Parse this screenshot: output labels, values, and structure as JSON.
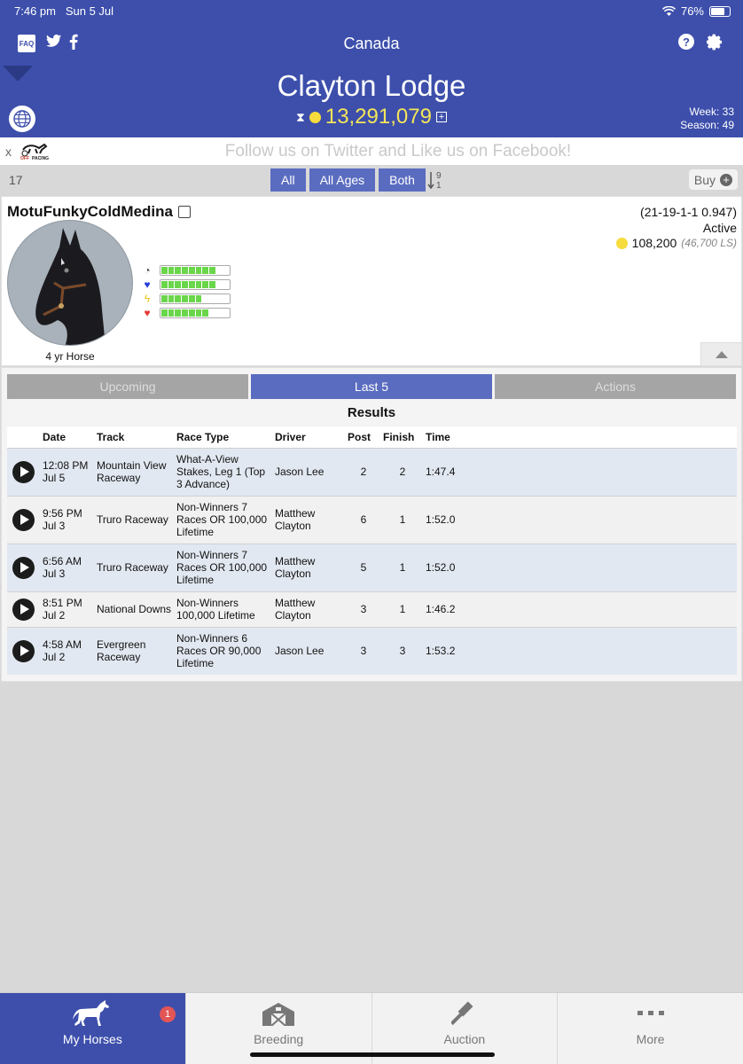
{
  "status": {
    "time": "7:46 pm",
    "date": "Sun 5 Jul",
    "battery": "76%",
    "battery_level": 0.76
  },
  "nav": {
    "title": "Canada",
    "faq": "FAQ",
    "twitter": "twitter-icon",
    "facebook": "facebook-icon",
    "help": "?",
    "settings": "gear-icon"
  },
  "header": {
    "lodge_name": "Clayton Lodge",
    "money": "13,291,079",
    "week_label": "Week: 33",
    "season_label": "Season: 49"
  },
  "banner": {
    "close": "x",
    "logo_line1": "OFF",
    "logo_line2": "PACING",
    "text": "Follow us on Twitter and Like us on Facebook!"
  },
  "filters": {
    "count": "17",
    "buttons": [
      "All",
      "All Ages",
      "Both"
    ],
    "sort_top": "9",
    "sort_bottom": "1",
    "buy": "Buy"
  },
  "horse": {
    "name": "MotuFunkyColdMedina",
    "record": "(21-19-1-1 0.947)",
    "status": "Active",
    "earnings": "108,200",
    "earnings_ls": "(46,700 LS)",
    "age_label": "4 yr Horse",
    "stats": [
      {
        "icon": "speed-icon",
        "glyph": "◔",
        "color": "#444",
        "level": 0.75
      },
      {
        "icon": "heart-monitor-icon",
        "glyph": "♥",
        "color": "#2a3fd6",
        "level": 0.84
      },
      {
        "icon": "lightning-icon",
        "glyph": "ϟ",
        "color": "#f1c40f",
        "level": 0.58
      },
      {
        "icon": "heart-icon",
        "glyph": "♥",
        "color": "#e53935",
        "level": 0.66
      }
    ]
  },
  "tabs": {
    "upcoming": "Upcoming",
    "last5": "Last 5",
    "actions": "Actions"
  },
  "results": {
    "title": "Results",
    "headers": {
      "date": "Date",
      "track": "Track",
      "race_type": "Race Type",
      "driver": "Driver",
      "post": "Post",
      "finish": "Finish",
      "time": "Time"
    },
    "rows": [
      {
        "time_of_day": "12:08 PM",
        "date": "Jul 5",
        "track": "Mountain View Raceway",
        "race_type": "What-A-View Stakes, Leg 1 (Top 3 Advance)",
        "driver": "Jason Lee",
        "post": "2",
        "finish": "2",
        "race_time": "1:47.4"
      },
      {
        "time_of_day": "9:56 PM",
        "date": "Jul 3",
        "track": "Truro Raceway",
        "race_type": "Non-Winners 7 Races OR 100,000 Lifetime",
        "driver": "Matthew Clayton",
        "post": "6",
        "finish": "1",
        "race_time": "1:52.0"
      },
      {
        "time_of_day": "6:56 AM",
        "date": "Jul 3",
        "track": "Truro Raceway",
        "race_type": "Non-Winners 7 Races OR 100,000 Lifetime",
        "driver": "Matthew Clayton",
        "post": "5",
        "finish": "1",
        "race_time": "1:52.0"
      },
      {
        "time_of_day": "8:51 PM",
        "date": "Jul 2",
        "track": "National Downs",
        "race_type": "Non-Winners 100,000 Lifetime",
        "driver": "Matthew Clayton",
        "post": "3",
        "finish": "1",
        "race_time": "1:46.2"
      },
      {
        "time_of_day": "4:58 AM",
        "date": "Jul 2",
        "track": "Evergreen Raceway",
        "race_type": "Non-Winners 6 Races OR 90,000 Lifetime",
        "driver": "Jason Lee",
        "post": "3",
        "finish": "3",
        "race_time": "1:53.2"
      }
    ]
  },
  "tabbar": {
    "my_horses": "My Horses",
    "my_horses_badge": "1",
    "breeding": "Breeding",
    "auction": "Auction",
    "more": "More"
  },
  "colors": {
    "brand": "#3d4fab",
    "accent": "#5a6cc0",
    "gold": "#f4e45a",
    "bar_fill": "#6ad64a"
  }
}
